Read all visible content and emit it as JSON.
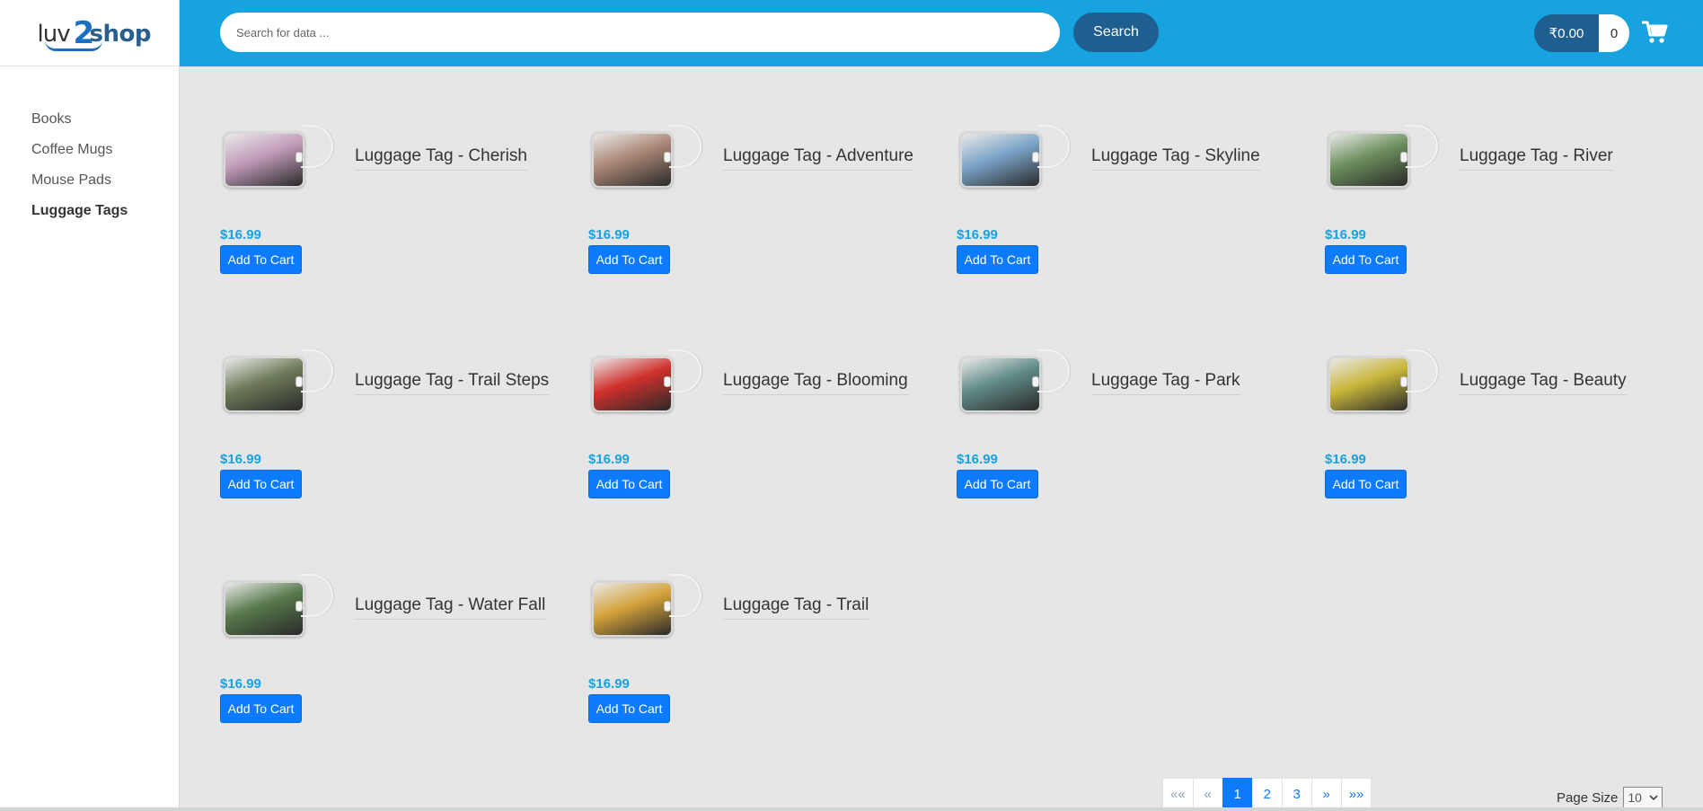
{
  "brand": {
    "logo_text": "luv2shop"
  },
  "sidebar": {
    "categories": [
      {
        "label": "Books"
      },
      {
        "label": "Coffee Mugs"
      },
      {
        "label": "Mouse Pads"
      },
      {
        "label": "Luggage Tags"
      }
    ],
    "active_category": "Luggage Tags"
  },
  "header": {
    "search_placeholder": "Search for data ...",
    "search_label": "Search",
    "cart_total": "₹0.00",
    "cart_quantity": "0"
  },
  "products": [
    {
      "name": "Luggage Tag - Cherish",
      "price": "$16.99",
      "button": "Add To Cart",
      "thumb": "#c09ab8"
    },
    {
      "name": "Luggage Tag - Adventure",
      "price": "$16.99",
      "button": "Add To Cart",
      "thumb": "#a98674"
    },
    {
      "name": "Luggage Tag - Skyline",
      "price": "$16.99",
      "button": "Add To Cart",
      "thumb": "#7aa3c8"
    },
    {
      "name": "Luggage Tag - River",
      "price": "$16.99",
      "button": "Add To Cart",
      "thumb": "#6c8f5c"
    },
    {
      "name": "Luggage Tag - Trail Steps",
      "price": "$16.99",
      "button": "Add To Cart",
      "thumb": "#6d7a58"
    },
    {
      "name": "Luggage Tag - Blooming",
      "price": "$16.99",
      "button": "Add To Cart",
      "thumb": "#d0302c"
    },
    {
      "name": "Luggage Tag - Park",
      "price": "$16.99",
      "button": "Add To Cart",
      "thumb": "#5f8a86"
    },
    {
      "name": "Luggage Tag - Beauty",
      "price": "$16.99",
      "button": "Add To Cart",
      "thumb": "#c8b63a"
    },
    {
      "name": "Luggage Tag - Water Fall",
      "price": "$16.99",
      "button": "Add To Cart",
      "thumb": "#56784a"
    },
    {
      "name": "Luggage Tag - Trail",
      "price": "$16.99",
      "button": "Add To Cart",
      "thumb": "#d4a23a"
    }
  ],
  "pagination": {
    "first": "««",
    "prev": "«",
    "pages": [
      "1",
      "2",
      "3"
    ],
    "active_page": "1",
    "next": "»",
    "last": "»»",
    "page_size_label": "Page Size",
    "page_size": "10"
  },
  "colors": {
    "header": "#17a2e0",
    "accent_dark": "#1f5f90",
    "button": "#0d7bff",
    "price": "#17a2e0",
    "background": "#e6e6e6"
  }
}
